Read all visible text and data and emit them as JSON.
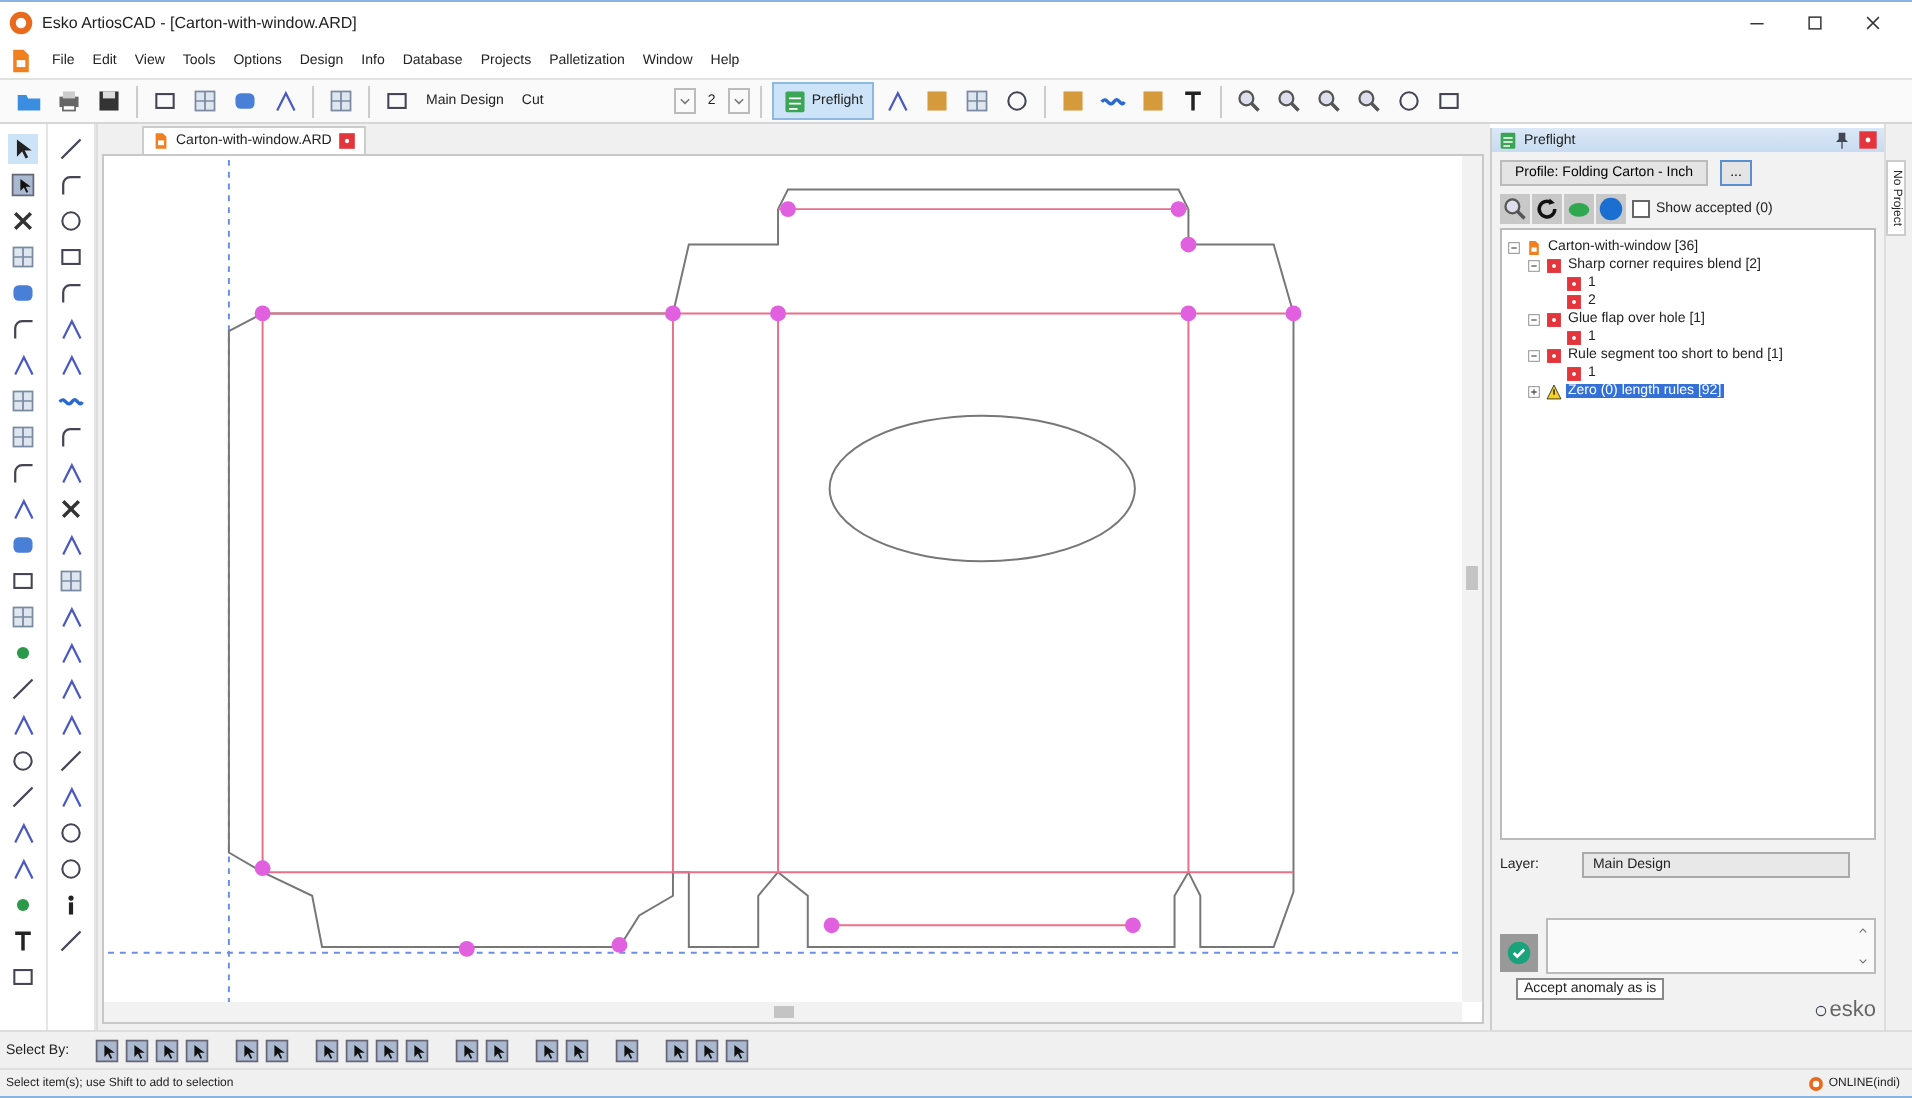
{
  "window": {
    "title": "Esko ArtiosCAD - [Carton-with-window.ARD]"
  },
  "menu": [
    "File",
    "Edit",
    "View",
    "Tools",
    "Options",
    "Design",
    "Info",
    "Database",
    "Projects",
    "Palletization",
    "Window",
    "Help"
  ],
  "toolbar": {
    "design_name": "Main Design",
    "mode": "Cut",
    "count": "2",
    "preflight": {
      "label": "Preflight",
      "selected": true
    }
  },
  "document_tab": {
    "label": "Carton-with-window.ARD"
  },
  "preflight": {
    "title": "Preflight",
    "profile_button": "Profile: Folding Carton - Inch",
    "more_button": "...",
    "show_accepted": {
      "label": "Show accepted (0)",
      "checked": false
    },
    "tree": [
      {
        "label": "Carton-with-window [36]",
        "kind": "design",
        "expanded": true,
        "selected": false,
        "children": [
          {
            "label": "Sharp corner requires blend [2]",
            "kind": "error",
            "expanded": true,
            "selected": false,
            "children": [
              {
                "label": "1",
                "kind": "error",
                "selected": false
              },
              {
                "label": "2",
                "kind": "error",
                "selected": false
              }
            ]
          },
          {
            "label": "Glue flap over hole [1]",
            "kind": "error",
            "expanded": true,
            "selected": false,
            "children": [
              {
                "label": "1",
                "kind": "error",
                "selected": false
              }
            ]
          },
          {
            "label": "Rule segment too short to bend [1]",
            "kind": "error",
            "expanded": true,
            "selected": false,
            "children": [
              {
                "label": "1",
                "kind": "error",
                "selected": false
              }
            ]
          },
          {
            "label": "Zero (0) length rules [92]",
            "kind": "warning",
            "expanded": false,
            "selected": true
          }
        ]
      }
    ],
    "layer_label": "Layer:",
    "layer_value": "Main Design",
    "tooltip": "Accept anomaly as is",
    "logo": "esko"
  },
  "side_tab": "No Project",
  "select_by": {
    "label": "Select By:"
  },
  "status_bar": {
    "text": "Select item(s); use Shift to add to selection",
    "connection": "ONLINE(indi)"
  }
}
